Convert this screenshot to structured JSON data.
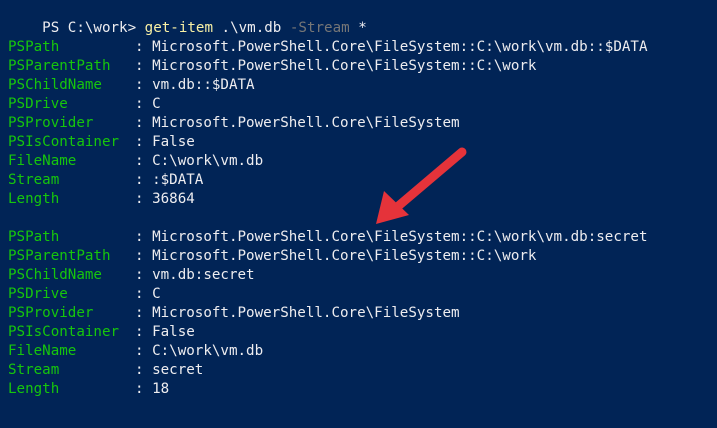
{
  "prompt": {
    "prefix": "PS C:\\work> ",
    "command": "get-item",
    "argument": " .\\vm.db ",
    "parameter": "-Stream",
    "wildcard": " *"
  },
  "records": [
    {
      "rows": [
        {
          "key": "PSPath",
          "value": "Microsoft.PowerShell.Core\\FileSystem::C:\\work\\vm.db::$DATA"
        },
        {
          "key": "PSParentPath",
          "value": "Microsoft.PowerShell.Core\\FileSystem::C:\\work"
        },
        {
          "key": "PSChildName",
          "value": "vm.db::$DATA"
        },
        {
          "key": "PSDrive",
          "value": "C"
        },
        {
          "key": "PSProvider",
          "value": "Microsoft.PowerShell.Core\\FileSystem"
        },
        {
          "key": "PSIsContainer",
          "value": "False"
        },
        {
          "key": "FileName",
          "value": "C:\\work\\vm.db"
        },
        {
          "key": "Stream",
          "value": ":$DATA"
        },
        {
          "key": "Length",
          "value": "36864"
        }
      ]
    },
    {
      "rows": [
        {
          "key": "PSPath",
          "value": "Microsoft.PowerShell.Core\\FileSystem::C:\\work\\vm.db:secret"
        },
        {
          "key": "PSParentPath",
          "value": "Microsoft.PowerShell.Core\\FileSystem::C:\\work"
        },
        {
          "key": "PSChildName",
          "value": "vm.db:secret"
        },
        {
          "key": "PSDrive",
          "value": "C"
        },
        {
          "key": "PSProvider",
          "value": "Microsoft.PowerShell.Core\\FileSystem"
        },
        {
          "key": "PSIsContainer",
          "value": "False"
        },
        {
          "key": "FileName",
          "value": "C:\\work\\vm.db"
        },
        {
          "key": "Stream",
          "value": "secret"
        },
        {
          "key": "Length",
          "value": "18"
        }
      ]
    }
  ],
  "separator": ": ",
  "colors": {
    "background": "#012456",
    "key": "#16c60c",
    "text": "#eeedf0",
    "command": "#f9f1a5",
    "parameter": "#767676",
    "annotation_arrow": "#e5333a"
  },
  "annotation": {
    "icon": "red-arrow-icon"
  }
}
